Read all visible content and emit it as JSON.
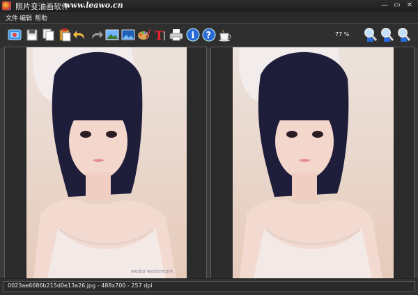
{
  "window": {
    "title": "照片变油画软件",
    "url": "www.leawo.cn",
    "minimize_glyph": "—",
    "maximize_glyph": "▭",
    "close_glyph": "✕"
  },
  "menu": {
    "items": [
      {
        "label": "文件"
      },
      {
        "label": "编辑"
      },
      {
        "label": "帮助"
      }
    ]
  },
  "toolbar": {
    "icons": [
      "open-image-icon",
      "save-icon",
      "copy-icon",
      "paste-icon",
      "undo-icon",
      "redo-icon",
      "image-icon",
      "image-landscape-icon",
      "paint-palette-icon",
      "text-tool-icon",
      "print-icon",
      "info-icon",
      "help-icon",
      "coffee-icon",
      "zoom-in-icon",
      "zoom-out-icon",
      "zoom-fit-icon"
    ],
    "zoom_level": "77 %"
  },
  "status": {
    "text": "0023ae6686b215d0e13a26.jpg - 488x700 - 257 dpi"
  },
  "colors": {
    "background": "#3a3a3a",
    "toolbar": "#2f2f2f",
    "titlebar": "#1e1e1e",
    "accent_blue": "#2a6ad8"
  }
}
